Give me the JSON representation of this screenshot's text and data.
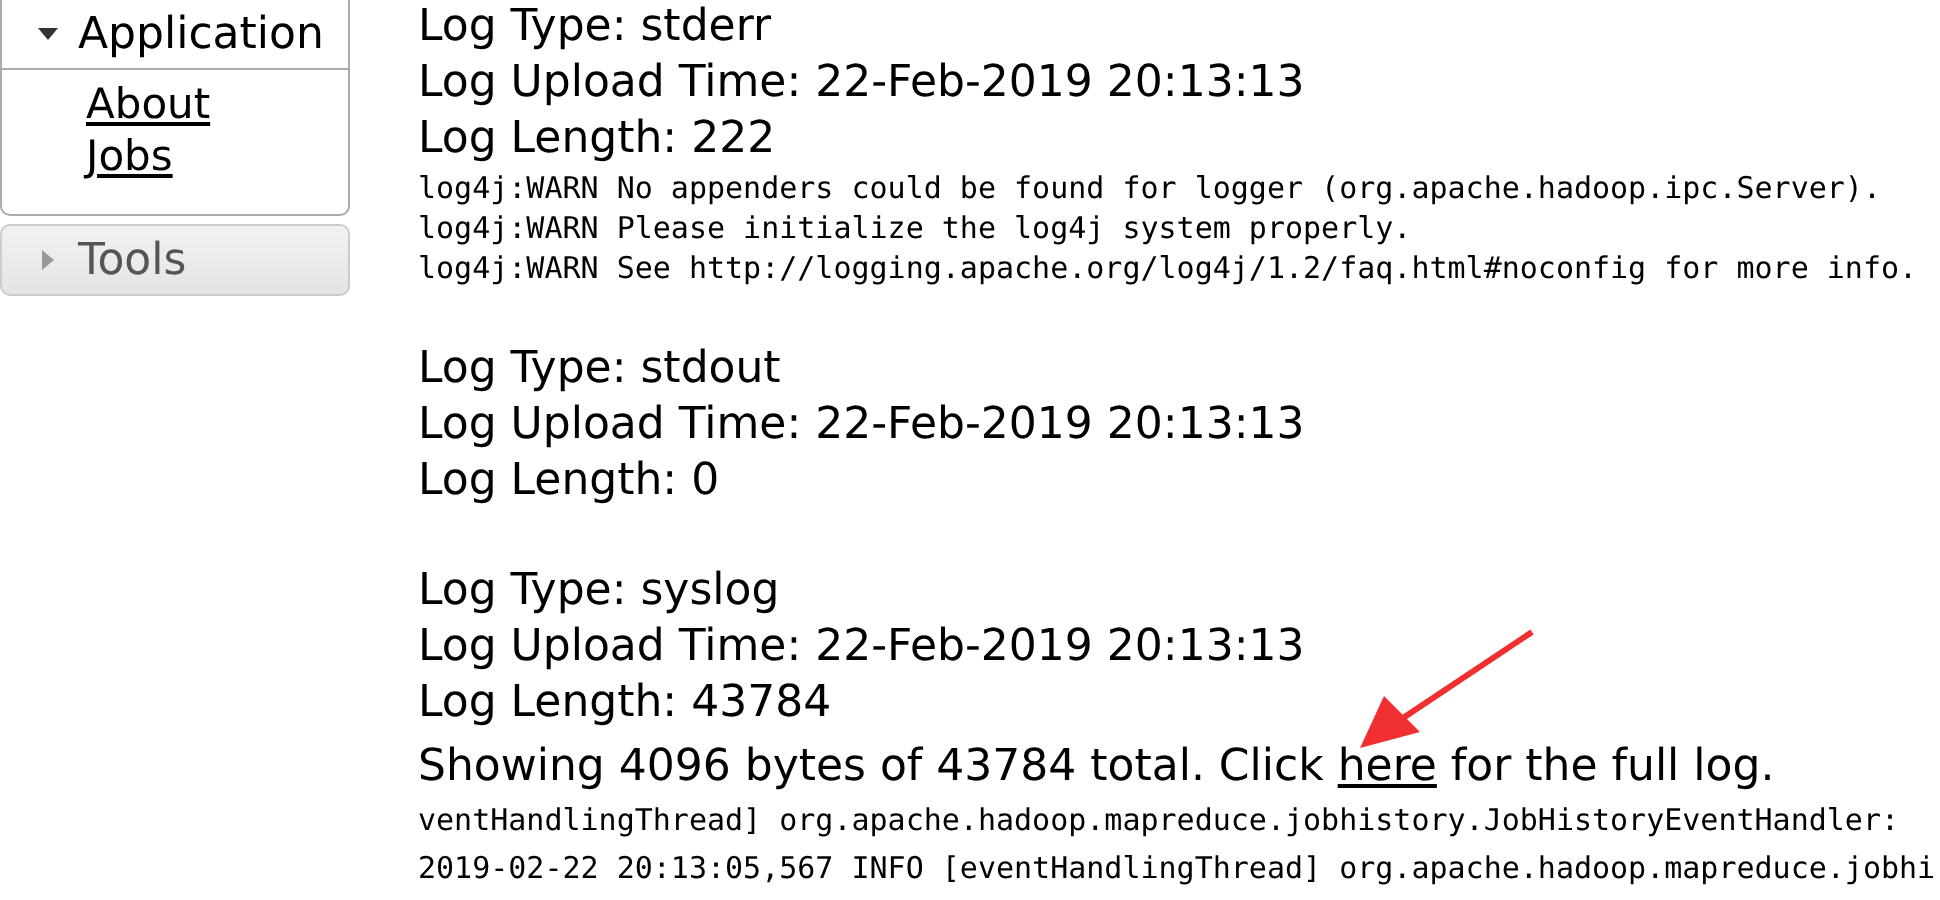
{
  "sidebar": {
    "sections": [
      {
        "title": "Application",
        "expanded": true,
        "items": [
          "About",
          "Jobs"
        ]
      },
      {
        "title": "Tools",
        "expanded": false
      }
    ]
  },
  "logs": [
    {
      "type": "Log Type: stderr",
      "upload_time": "Log Upload Time: 22-Feb-2019 20:13:13",
      "length": "Log Length: 222",
      "lines": [
        "log4j:WARN No appenders could be found for logger (org.apache.hadoop.ipc.Server).",
        "log4j:WARN Please initialize the log4j system properly.",
        "log4j:WARN See http://logging.apache.org/log4j/1.2/faq.html#noconfig for more info."
      ]
    },
    {
      "type": "Log Type: stdout",
      "upload_time": "Log Upload Time: 22-Feb-2019 20:13:13",
      "length": "Log Length: 0"
    },
    {
      "type": "Log Type: syslog",
      "upload_time": "Log Upload Time: 22-Feb-2019 20:13:13",
      "length": "Log Length: 43784",
      "notice": {
        "before": "Showing 4096 bytes of 43784 total. Click ",
        "link": "here",
        "after": " for the full log."
      },
      "lines": [
        "ventHandlingThread] org.apache.hadoop.mapreduce.jobhistory.JobHistoryEventHandler:",
        "2019-02-22 20:13:05,567 INFO [eventHandlingThread] org.apache.hadoop.mapreduce.jobhi"
      ]
    }
  ]
}
